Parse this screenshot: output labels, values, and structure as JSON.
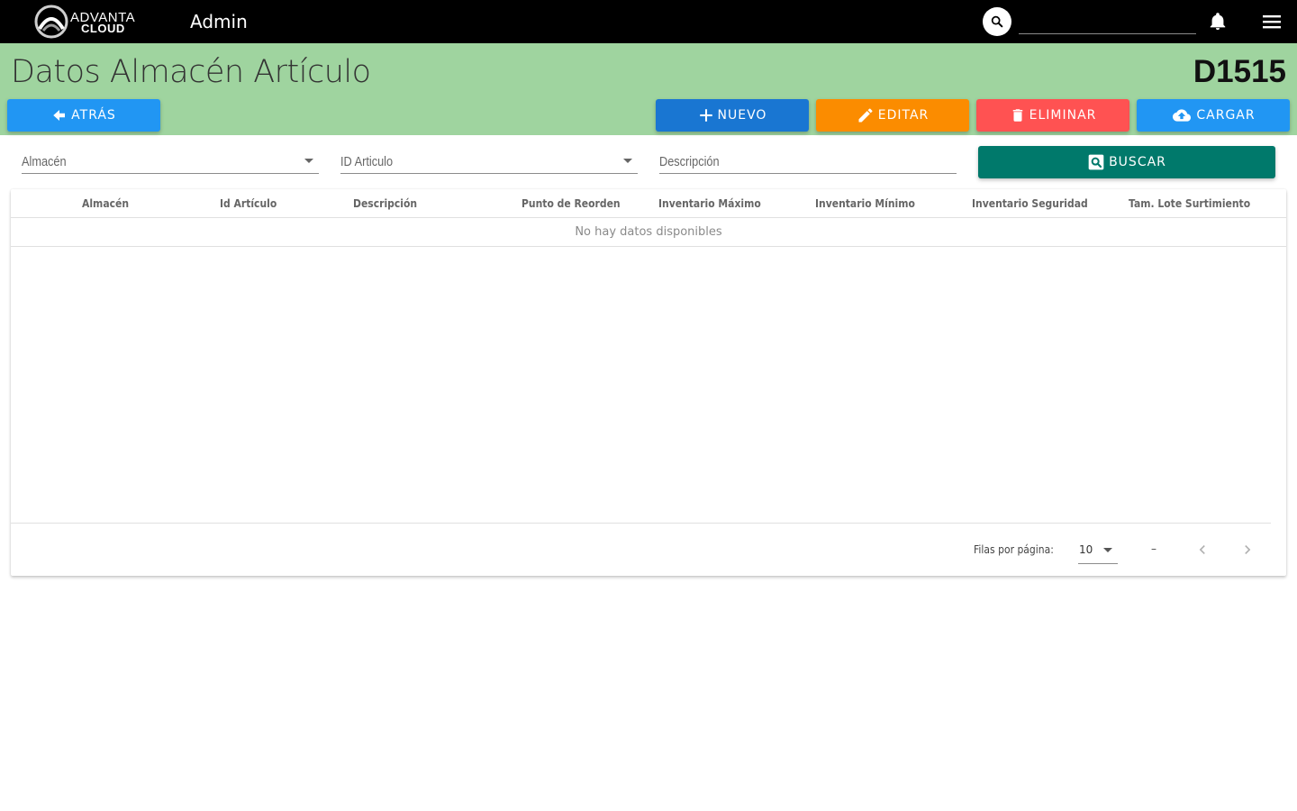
{
  "topbar": {
    "logo_line1": "ADVANTA",
    "logo_line2": "CLOUD",
    "app_title": "Admin",
    "search_value": "",
    "icons": [
      "search-icon",
      "bell-icon",
      "menu-icon"
    ]
  },
  "header": {
    "title": "Datos Almacén Artículo",
    "code": "D1515"
  },
  "actions": {
    "back": "ATRÁS",
    "new": "NUEVO",
    "edit": "EDITAR",
    "delete": "ELIMINAR",
    "load": "CARGAR",
    "search": "BUSCAR"
  },
  "filters": {
    "warehouse_label": "Almacén",
    "item_id_label": "ID Articulo",
    "description_label": "Descripción"
  },
  "table": {
    "columns": [
      "Almacén",
      "Id Artículo",
      "Descripción",
      "Punto de Reorden",
      "Inventario Máximo",
      "Inventario Mínimo",
      "Inventario Seguridad",
      "Tam. Lote Surtimiento"
    ],
    "empty_message": "No hay datos disponibles"
  },
  "pagination": {
    "rows_per_page_label": "Filas por página:",
    "rows_per_page_value": "10",
    "range_text": "–"
  },
  "colors": {
    "topbar": "#000000",
    "header": "#9fd49f",
    "back": "#2196f3",
    "new": "#1976d2",
    "edit": "#fb8c00",
    "delete": "#ff5252",
    "load": "#2196f3",
    "search": "#00796b"
  }
}
